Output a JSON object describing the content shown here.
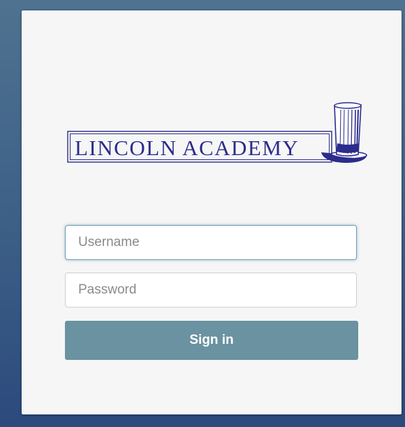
{
  "logo": {
    "text": "LINCOLN ACADEMY",
    "icon": "top-hat-icon",
    "color": "#2b2c8c"
  },
  "form": {
    "username": {
      "placeholder": "Username",
      "value": ""
    },
    "password": {
      "placeholder": "Password",
      "value": ""
    },
    "sign_in_label": "Sign in"
  },
  "colors": {
    "background": "#3f6388",
    "card": "#f6f6f6",
    "button": "#6a92a0",
    "focus_ring": "#6f9db6"
  }
}
